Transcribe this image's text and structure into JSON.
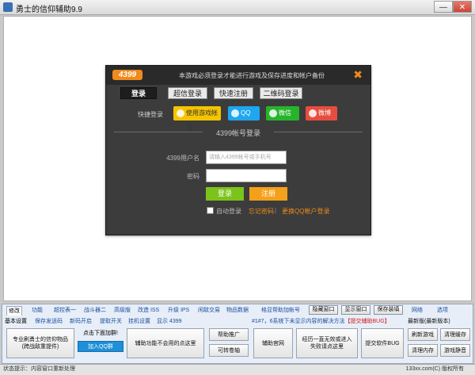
{
  "window": {
    "title": "勇士的信仰辅助9.9",
    "min_label": "—",
    "close_label": "✕"
  },
  "dialog": {
    "logo": "4399",
    "notice": "本游戏必须登录才能进行游戏及保存进度和帐户备份",
    "close_label": "✖",
    "tabs": [
      "登录",
      "超信登录",
      "快速注册",
      "二维码登录"
    ],
    "quick_login_label": "快捷登录",
    "quick_buttons": [
      "使用游戏帐号",
      "QQ",
      "微信",
      "微博"
    ],
    "section_title": "4399帐号登录",
    "username_label": "4399用户名",
    "username_placeholder": "请输入4399帐号或手机号",
    "password_label": "密码",
    "login_button": "登录",
    "register_button": "注册",
    "remember_label": "自动登录",
    "forgot_link": "忘记密码",
    "sep": "|",
    "other_link": "更换QQ帐户登录"
  },
  "toolpanel": {
    "top_tabs": [
      "修改",
      "功能",
      "超控表一",
      "战斗器二",
      "高级版",
      "改造 ISS",
      "升级 IPS",
      "闲敌交易",
      "物品数据"
    ],
    "sub_tabs": [
      "基本设置",
      "保存发送码",
      "新码开启",
      "提取开关",
      "挂机设置",
      "显示 4399"
    ],
    "middle_header": "格显帮助加帐号",
    "group_buttons": [
      "隐藏窗口",
      "显示窗口",
      "保存装填"
    ],
    "right_tabs": [
      "网络",
      "选项"
    ],
    "note": "#1#7，6系统下未显示内容的解决方法",
    "note_highlight": "【提交辅助BUG】",
    "right_selected": "最新版(最新版本)",
    "buttons": {
      "collect": "专业刷勇士的信仰物品\n(跨战敌重提件)",
      "add_tip": "点击下面加群!",
      "qq_group": "加入QQ群",
      "auto_ignore": "辅助功能不会用的点这里",
      "helper_promote": "帮助推广",
      "clear_slots": "可转卷轴",
      "helper_website": "辅助官网",
      "ie_fix": "经历一直无效或进入\n失败请点这里",
      "submit_bug": "提交软件BUG",
      "refresh_game": "刷新游戏",
      "clear_cache": "清理缓存",
      "clear_memory": "清理内存",
      "game_mute": "游戏静音"
    }
  },
  "statusbar": {
    "left": "状态提示：内容窗口重新处理",
    "right": "133xx.com(C) 版权所有"
  }
}
